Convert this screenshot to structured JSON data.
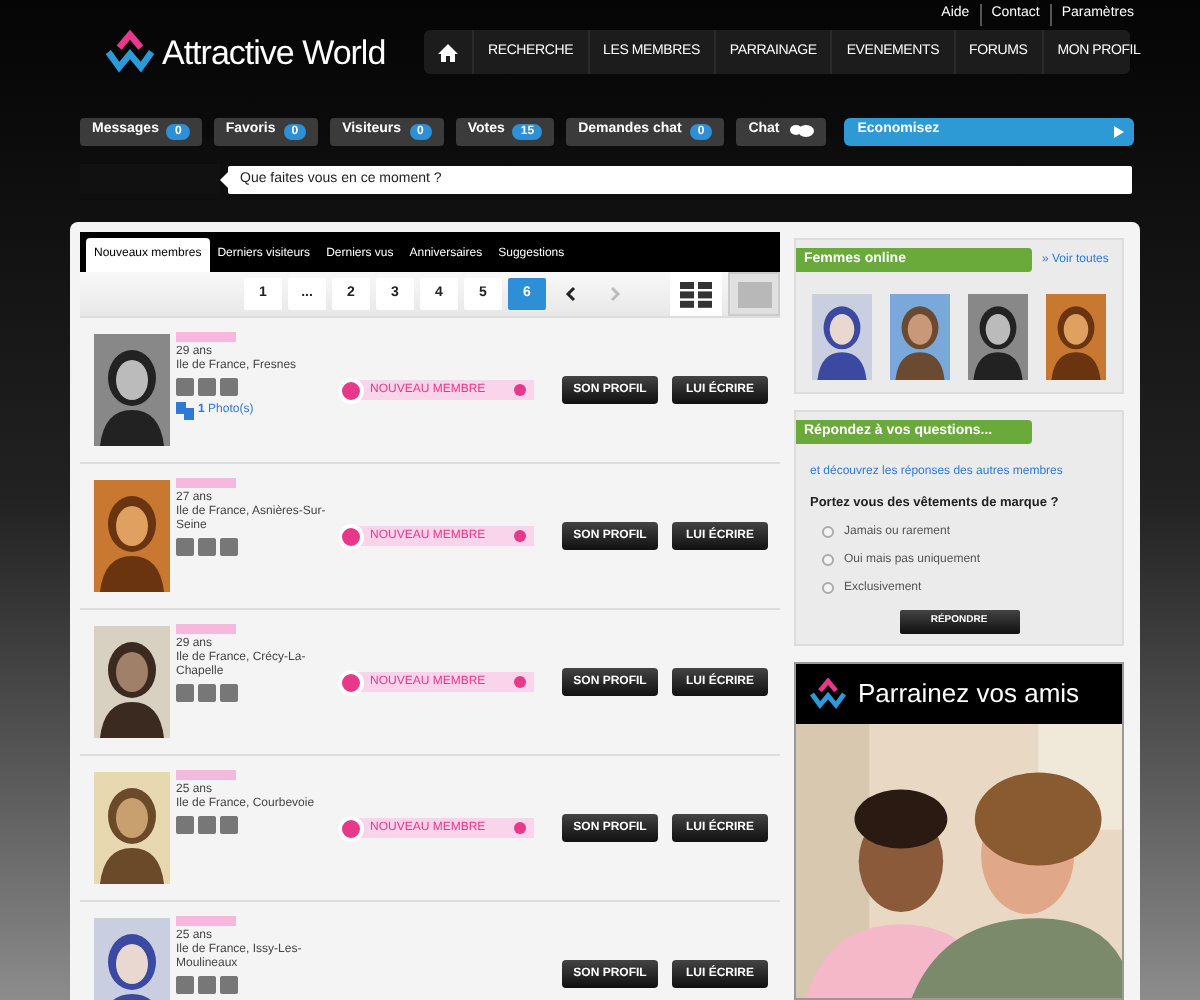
{
  "top_links": [
    "Aide",
    "Contact",
    "Paramètres"
  ],
  "logo": {
    "text": "Attractive World"
  },
  "nav": {
    "items": [
      "RECHERCHE",
      "LES MEMBRES",
      "PARRAINAGE",
      "EVENEMENTS",
      "FORUMS",
      "MON PROFIL"
    ]
  },
  "counters": [
    {
      "kind": "count",
      "label": "Messages",
      "count": "0"
    },
    {
      "kind": "count",
      "label": "Favoris",
      "count": "0"
    },
    {
      "kind": "count",
      "label": "Visiteurs",
      "count": "0"
    },
    {
      "kind": "count",
      "label": "Votes",
      "count": "15"
    },
    {
      "kind": "count",
      "label": "Demandes chat",
      "count": "0"
    },
    {
      "kind": "chat",
      "label": "Chat"
    },
    {
      "kind": "promo",
      "label": "Economisez"
    }
  ],
  "status": {
    "placeholder": "Que faites vous en ce moment ?"
  },
  "tabs": [
    {
      "label": "Nouveaux membres",
      "selected": true
    },
    {
      "label": "Derniers visiteurs",
      "selected": false
    },
    {
      "label": "Derniers vus",
      "selected": false
    },
    {
      "label": "Anniversaires",
      "selected": false
    },
    {
      "label": "Suggestions",
      "selected": false
    }
  ],
  "pagination": {
    "pages": [
      {
        "label": "1",
        "selected": false
      },
      {
        "label": "...",
        "selected": false
      },
      {
        "label": "2",
        "selected": false
      },
      {
        "label": "3",
        "selected": false
      },
      {
        "label": "4",
        "selected": false
      },
      {
        "label": "5",
        "selected": false
      },
      {
        "label": "6",
        "selected": true
      }
    ],
    "prev_disabled": false,
    "next_disabled": true
  },
  "views": [
    {
      "kind": "grid",
      "selected": true
    },
    {
      "kind": "list",
      "selected": false
    }
  ],
  "members": [
    {
      "age": "29 ans",
      "location": "Ile de France, Fresnes",
      "photos": {
        "count": "1",
        "label": "Photo(s)"
      },
      "badge": "NOUVEAU MEMBRE",
      "buttons": [
        "SON PROFIL",
        "LUI ÉCRIRE"
      ]
    },
    {
      "age": "27 ans",
      "location": "Ile de France, Asnières-Sur-Seine",
      "badge": "NOUVEAU MEMBRE",
      "buttons": [
        "SON PROFIL",
        "LUI ÉCRIRE"
      ]
    },
    {
      "age": "29 ans",
      "location": "Ile de France, Crécy-La-Chapelle",
      "badge": "NOUVEAU MEMBRE",
      "buttons": [
        "SON PROFIL",
        "LUI ÉCRIRE"
      ]
    },
    {
      "age": "25 ans",
      "location": "Ile de France, Courbevoie",
      "badge": "NOUVEAU MEMBRE",
      "buttons": [
        "SON PROFIL",
        "LUI ÉCRIRE"
      ]
    },
    {
      "age": "25 ans",
      "location": "Ile de France, Issy-Les-Moulineaux",
      "buttons": [
        "SON PROFIL",
        "LUI ÉCRIRE"
      ]
    }
  ],
  "online": {
    "title": "Femmes online",
    "link": "» Voir toutes"
  },
  "poll": {
    "title": "Répondez à vos questions...",
    "subtitle": "et découvrez les réponses des autres membres",
    "question": "Portez vous des vêtements de marque ?",
    "options": [
      {
        "label": "Jamais ou rarement",
        "selected": false
      },
      {
        "label": "Oui mais pas uniquement",
        "selected": false
      },
      {
        "label": "Exclusivement",
        "selected": false
      }
    ],
    "button": "RÉPONDRE"
  },
  "promo": {
    "title": "Parrainez vos amis"
  }
}
